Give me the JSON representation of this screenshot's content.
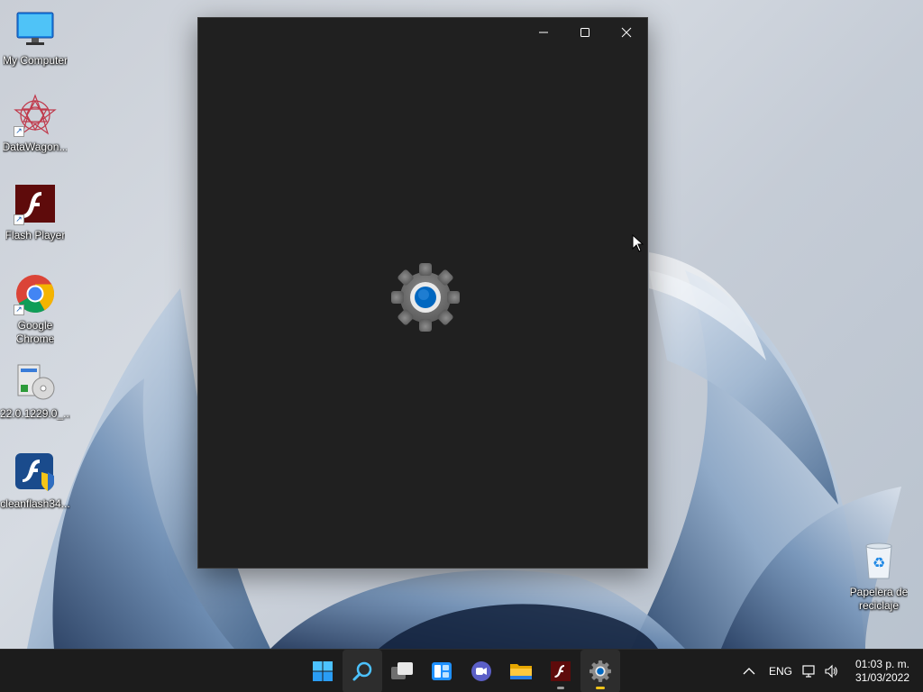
{
  "desktop": {
    "icons": [
      {
        "label": "My Computer",
        "icon": "monitor-icon"
      },
      {
        "label": "DataWagon...",
        "icon": "datawagon-icon"
      },
      {
        "label": "Flash Player",
        "icon": "flash-icon"
      },
      {
        "label": "Google\nChrome",
        "icon": "chrome-icon"
      },
      {
        "label": "22.0.1229.0_...",
        "icon": "installer-icon"
      },
      {
        "label": "cleanflash34...",
        "icon": "cleanflash-icon"
      }
    ],
    "recycle_bin": {
      "label": "Papelera de\nreciclaje",
      "icon": "recycle-bin-icon"
    }
  },
  "window": {
    "app": "Settings",
    "state": "loading",
    "controls": [
      "minimize-icon",
      "maximize-icon",
      "close-icon"
    ]
  },
  "taskbar": {
    "apps": [
      {
        "name": "start",
        "icon": "windows-logo-icon"
      },
      {
        "name": "search",
        "icon": "search-icon"
      },
      {
        "name": "task-view",
        "icon": "task-view-icon"
      },
      {
        "name": "widgets",
        "icon": "widgets-icon"
      },
      {
        "name": "chat",
        "icon": "teams-chat-icon"
      },
      {
        "name": "file-explorer",
        "icon": "folder-icon"
      },
      {
        "name": "flash-player",
        "icon": "flash-icon"
      },
      {
        "name": "settings",
        "icon": "gear-icon"
      }
    ],
    "tray": {
      "overflow_icon": "chevron-up-icon",
      "language": "ENG",
      "network_icon": "network-icon",
      "volume_icon": "volume-icon",
      "time": "01:03 p. m.",
      "date": "31/03/2022"
    }
  },
  "colors": {
    "window_bg": "#202020",
    "taskbar_bg": "#1c1c1c",
    "accent": "#0067c0",
    "focus_indicator": "#f0c419"
  }
}
